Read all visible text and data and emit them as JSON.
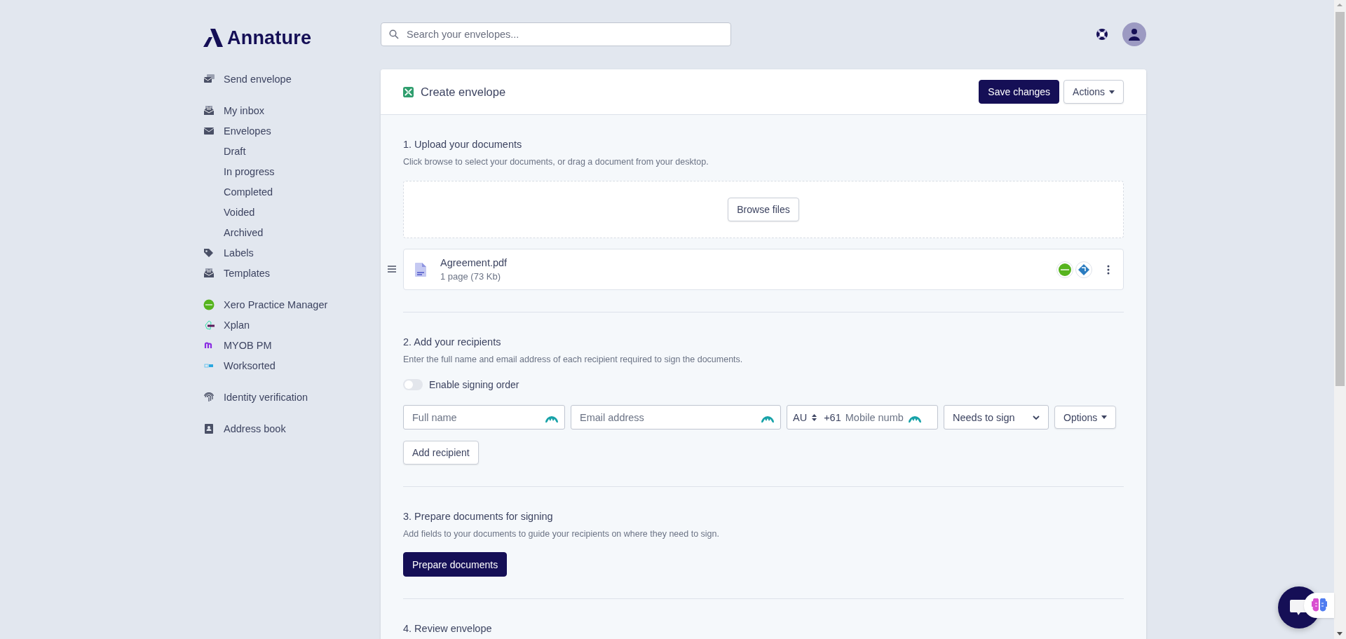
{
  "brand": {
    "name": "Annature"
  },
  "sidebar": {
    "sections": [
      {
        "items": [
          {
            "kind": "send",
            "label": "Send envelope"
          }
        ]
      },
      {
        "items": [
          {
            "kind": "inbox",
            "label": "My inbox"
          },
          {
            "kind": "envelope",
            "label": "Envelopes",
            "children": [
              {
                "label": "Draft"
              },
              {
                "label": "In progress"
              },
              {
                "label": "Completed"
              },
              {
                "label": "Voided"
              },
              {
                "label": "Archived"
              }
            ]
          },
          {
            "kind": "tag",
            "label": "Labels"
          },
          {
            "kind": "inbox",
            "label": "Templates"
          }
        ]
      },
      {
        "items": [
          {
            "kind": "xero",
            "label": "Xero Practice Manager"
          },
          {
            "kind": "iress",
            "label": "Xplan"
          },
          {
            "kind": "myob",
            "label": "MYOB PM"
          },
          {
            "kind": "worksorted",
            "label": "Worksorted"
          }
        ]
      },
      {
        "items": [
          {
            "kind": "fingerprint",
            "label": "Identity verification"
          }
        ]
      },
      {
        "items": [
          {
            "kind": "book",
            "label": "Address book"
          }
        ]
      }
    ]
  },
  "search": {
    "placeholder": "Search your envelopes..."
  },
  "card": {
    "title": "Create envelope",
    "buttons": [
      {
        "label": "Save changes",
        "kind": "primary"
      },
      {
        "label": "Actions",
        "kind": "dropdown"
      }
    ]
  },
  "upload": {
    "title": "1. Upload your documents",
    "description": "Click browse to select your documents, or drag a document from your desktop.",
    "browse_button": "Browse files",
    "files": [
      {
        "name": "Agreement.pdf",
        "details": "1 page (73 Kb)"
      }
    ]
  },
  "recipients": {
    "title": "2. Add your recipients",
    "description": "Enter the full name and email address of each recipient required to sign the documents.",
    "signing_order": {
      "label": "Enable signing order",
      "on": false
    },
    "full_name": {
      "placeholder": "Full name"
    },
    "email": {
      "placeholder": "Email address"
    },
    "phone": {
      "country": "AU",
      "dial_code": "+61",
      "placeholder": "Mobile numb"
    },
    "role": {
      "value": "Needs to sign"
    },
    "options_button": "Options",
    "add_button": "Add recipient"
  },
  "prepare": {
    "title": "3. Prepare documents for signing",
    "description": "Add fields to your documents to guide your recipients on where they need to sign.",
    "button": "Prepare documents"
  },
  "review": {
    "title": "4. Review envelope"
  }
}
